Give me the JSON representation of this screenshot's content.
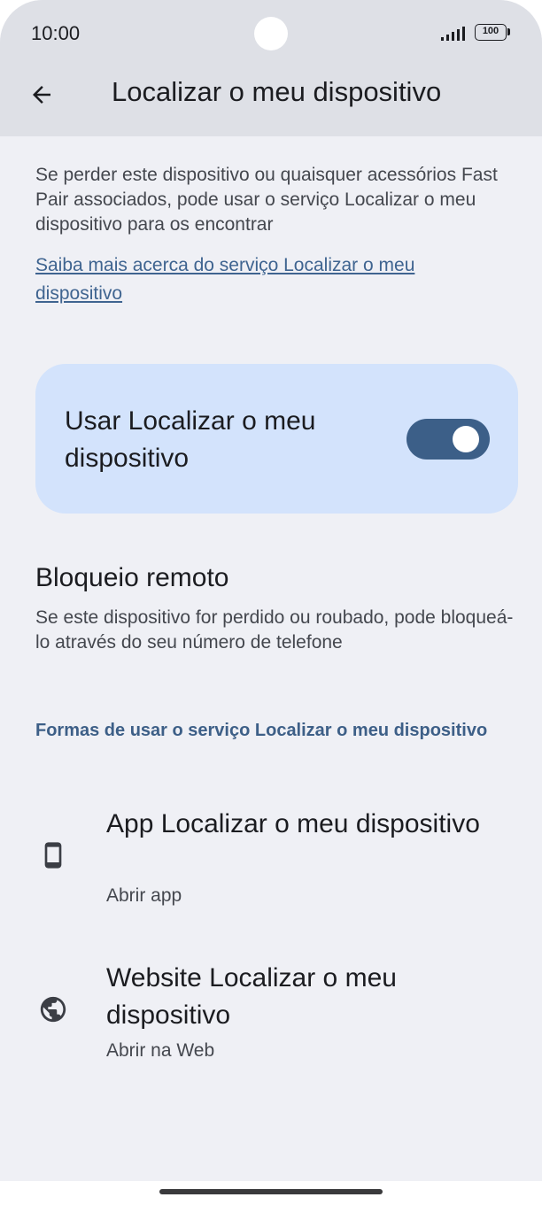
{
  "status_bar": {
    "time": "10:00",
    "battery": "100",
    "signal_icon": "signal-bars-icon",
    "battery_icon": "battery-icon"
  },
  "app_bar": {
    "back_icon": "arrow-back-icon",
    "title": "Localizar o meu dispositivo"
  },
  "intro": {
    "text": "Se perder este dispositivo ou quaisquer acessórios Fast Pair associados, pode usar o serviço Localizar o meu dispositivo para os encontrar",
    "link": "Saiba mais acerca do serviço Localizar o meu dispositivo"
  },
  "main_toggle": {
    "label": "Usar Localizar o meu dispositivo",
    "enabled": true
  },
  "remote_lock": {
    "title": "Bloqueio remoto",
    "summary": "Se este dispositivo for perdido ou roubado, pode bloqueá-lo através do seu número de telefone"
  },
  "ways_section": {
    "header": "Formas de usar o serviço Localizar o meu dispositivo",
    "items": [
      {
        "icon": "phone-device-icon",
        "title": "App Localizar o meu dispositivo",
        "subtitle": "Abrir app"
      },
      {
        "icon": "globe-icon",
        "title": "Website Localizar o meu dispositivo",
        "subtitle": "Abrir na Web"
      }
    ]
  },
  "colors": {
    "background": "#eff0f5",
    "app_bar": "#dee0e6",
    "card": "#d3e3fc",
    "switch_track": "#3c5f88",
    "accent_text": "#3d5f87"
  }
}
